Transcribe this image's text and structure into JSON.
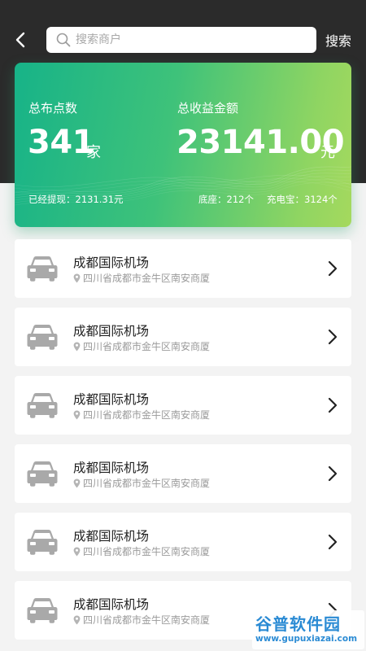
{
  "header": {
    "search_placeholder": "搜索商户",
    "search_button": "搜索"
  },
  "stats": {
    "total_points_label": "总布点数",
    "total_points_value": "341",
    "total_points_unit": "家",
    "total_income_label": "总收益金额",
    "total_income_value": "23141.00",
    "total_income_unit": "元",
    "withdrawn": "已经提现：2131.31元",
    "base": "底座：212个",
    "power_bank": "充电宝：3124个"
  },
  "merchants": [
    {
      "name": "成都国际机场",
      "address": "四川省成都市金牛区南安商厦"
    },
    {
      "name": "成都国际机场",
      "address": "四川省成都市金牛区南安商厦"
    },
    {
      "name": "成都国际机场",
      "address": "四川省成都市金牛区南安商厦"
    },
    {
      "name": "成都国际机场",
      "address": "四川省成都市金牛区南安商厦"
    },
    {
      "name": "成都国际机场",
      "address": "四川省成都市金牛区南安商厦"
    },
    {
      "name": "成都国际机场",
      "address": "四川省成都市金牛区南安商厦"
    }
  ],
  "watermark": {
    "brand_part1": "谷普",
    "brand_part2": "软件园",
    "url": "www.gupuxiazai.com"
  },
  "icons": {
    "back": "back-arrow-icon",
    "search": "search-icon",
    "merchant": "car-icon",
    "location": "location-pin-icon",
    "detail": "chevron-right-icon"
  },
  "colors": {
    "top_background": "#2b2b2b",
    "card_gradient_start": "#17b388",
    "card_gradient_end": "#a5d95e",
    "page_background": "#f3f3f3",
    "icon_gray": "#a9a9a9"
  }
}
